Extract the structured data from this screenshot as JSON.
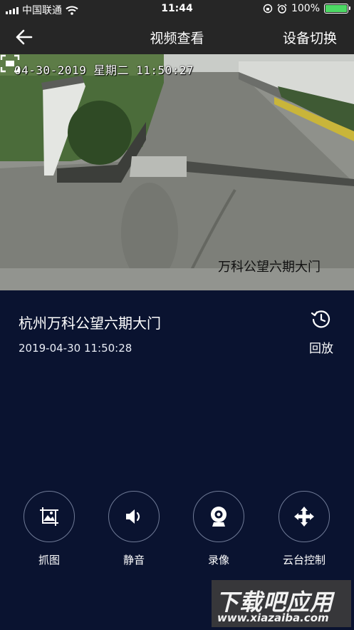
{
  "status_bar": {
    "carrier": "中国联通",
    "time": "11:44",
    "battery": "100%",
    "battery_level": 1.0,
    "icons": [
      "signal-icon",
      "wifi-icon",
      "rotation-lock-icon",
      "alarm-icon",
      "battery-icon"
    ]
  },
  "navbar": {
    "back_icon": "back-arrow-icon",
    "title": "视频查看",
    "switch_label": "设备切换"
  },
  "video": {
    "osd_timestamp": "04-30-2019 星期二 11:50:27",
    "osd_camera_name": "万科公望六期大门",
    "fullscreen_icon": "fullscreen-icon"
  },
  "info": {
    "camera_title": "杭州万科公望六期大门",
    "datetime": "2019-04-30 11:50:28",
    "playback_icon": "history-icon",
    "playback_label": "回放"
  },
  "controls": [
    {
      "icon": "snapshot-icon",
      "label": "抓图"
    },
    {
      "icon": "volume-icon",
      "label": "静音"
    },
    {
      "icon": "record-camera-icon",
      "label": "录像"
    },
    {
      "icon": "ptz-arrows-icon",
      "label": "云台控制"
    }
  ],
  "watermark": {
    "main": "下载吧应用",
    "sub": "www.xiazaiba.com"
  },
  "colors": {
    "background": "#0a1330",
    "bar": "#262626",
    "ctrl_border": "#6f7a96",
    "battery_fill": "#4cd964"
  }
}
